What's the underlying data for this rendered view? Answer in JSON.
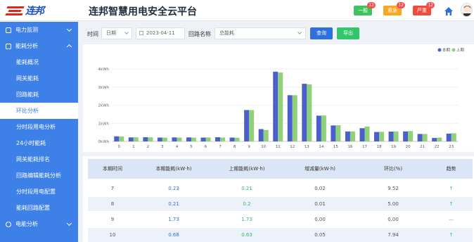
{
  "header": {
    "logo_text": "连邦",
    "title": "连邦智慧用电安全云平台",
    "alarms": [
      {
        "label": "一般",
        "count": "12",
        "color": "#3fc35f"
      },
      {
        "label": "紧急",
        "count": "12",
        "color": "#f7a724"
      },
      {
        "label": "严重",
        "count": "12",
        "color": "#f14b3b"
      }
    ]
  },
  "sidebar": {
    "menus": [
      {
        "label": "电力监测",
        "expanded": false
      },
      {
        "label": "能耗分析",
        "expanded": true
      }
    ],
    "sub_items": [
      "能耗概况",
      "网关能耗",
      "回路能耗",
      "环比分析",
      "分时段用电分析",
      "24小时能耗",
      "网关能耗排名",
      "回路编辑能耗分析",
      "分时段用电配置",
      "能耗回路配置"
    ],
    "active_index": 3,
    "bottom_menu": {
      "label": "电能分析"
    }
  },
  "filter": {
    "time_label": "时间",
    "time_type": "日期",
    "date_value": "2023-04-11",
    "loop_label": "回路名称",
    "loop_value": "总能耗",
    "query_btn": "查询",
    "export_btn": "导出"
  },
  "colors": {
    "current": "#4a5fcc",
    "previous": "#8fd17a"
  },
  "chart_data": {
    "type": "bar",
    "legend": [
      "本期",
      "上期"
    ],
    "legend_position": "top-right",
    "categories": [
      "0",
      "1",
      "2",
      "3",
      "4",
      "5",
      "6",
      "7",
      "8",
      "9",
      "10",
      "11",
      "12",
      "13",
      "14",
      "15",
      "16",
      "17",
      "18",
      "19",
      "20",
      "21",
      "22",
      "23"
    ],
    "series": [
      {
        "name": "本期",
        "values": [
          0.28,
          0.22,
          0.23,
          0.21,
          0.22,
          0.22,
          0.21,
          0.23,
          0.21,
          1.73,
          0.68,
          3.85,
          2.55,
          3.18,
          1.42,
          0.88,
          0.55,
          0.73,
          0.52,
          0.54,
          0.55,
          0.41,
          0.19,
          0.43
        ]
      },
      {
        "name": "上期",
        "values": [
          0.27,
          0.23,
          0.22,
          0.21,
          0.21,
          0.21,
          0.22,
          0.21,
          0.2,
          1.73,
          0.63,
          3.8,
          2.55,
          3.15,
          1.43,
          0.89,
          0.55,
          0.82,
          0.53,
          0.55,
          0.57,
          0.41,
          0.21,
          0.45
        ]
      }
    ],
    "y_ticks": [
      "0kWh",
      "1kWh",
      "2kWh",
      "3kWh",
      "4kWh"
    ],
    "ylim": [
      0,
      4
    ],
    "grid": true
  },
  "table": {
    "headers": [
      "本期时间",
      "本期能耗(kW·h)",
      "上期能耗(kW·h)",
      "增减量(kW·h)",
      "环比(%)",
      "趋势"
    ],
    "rows": [
      [
        "7",
        "0.23",
        "0.21",
        "0.02",
        "9.52",
        "↑"
      ],
      [
        "8",
        "0.21",
        "0.2",
        "0.01",
        "5.00",
        "↑"
      ],
      [
        "9",
        "1.73",
        "1.73",
        "0.00",
        "0.00",
        "—"
      ],
      [
        "10",
        "0.68",
        "0.63",
        "0.05",
        "7.94",
        "↑"
      ]
    ]
  }
}
